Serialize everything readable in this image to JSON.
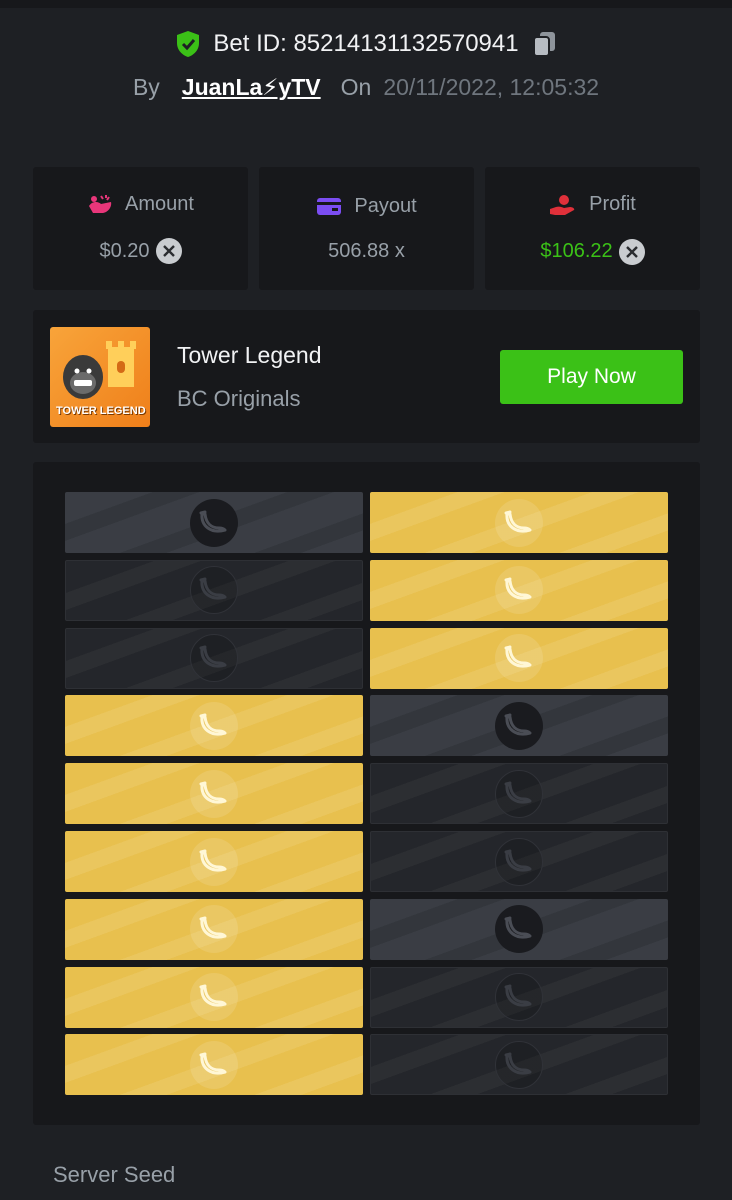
{
  "header": {
    "bet_id_label": "Bet ID: 85214131132570941",
    "by_label": "By",
    "username": "JuanLa⚡yTV",
    "on_label": "On",
    "datetime": "20/11/2022, 12:05:32"
  },
  "stats": {
    "amount": {
      "label": "Amount",
      "value": "$0.20",
      "icon": "amount-icon",
      "color": "#e8367a"
    },
    "payout": {
      "label": "Payout",
      "value": "506.88 x",
      "icon": "card-icon",
      "color": "#7b4df2"
    },
    "profit": {
      "label": "Profit",
      "value": "$106.22",
      "icon": "profit-hand-icon",
      "color": "#e0303a",
      "value_color": "#3bc117"
    }
  },
  "game": {
    "thumbnail_text": "TOWER LEGEND",
    "title": "Tower Legend",
    "provider": "BC Originals",
    "play_label": "Play Now"
  },
  "board": {
    "rows": [
      [
        "active-dark",
        "gold"
      ],
      [
        "dim",
        "gold"
      ],
      [
        "dim",
        "gold"
      ],
      [
        "gold",
        "active-dark"
      ],
      [
        "gold",
        "dim"
      ],
      [
        "gold",
        "dim"
      ],
      [
        "gold",
        "active-dark"
      ],
      [
        "gold",
        "dim"
      ],
      [
        "gold",
        "dim"
      ]
    ],
    "tile_icon": "banana-icon"
  },
  "footer": {
    "server_seed_label": "Server Seed"
  },
  "colors": {
    "accent_green": "#3bc117",
    "gold_tile": "#e8c04e",
    "background": "#1e2024",
    "panel": "#17181b"
  }
}
